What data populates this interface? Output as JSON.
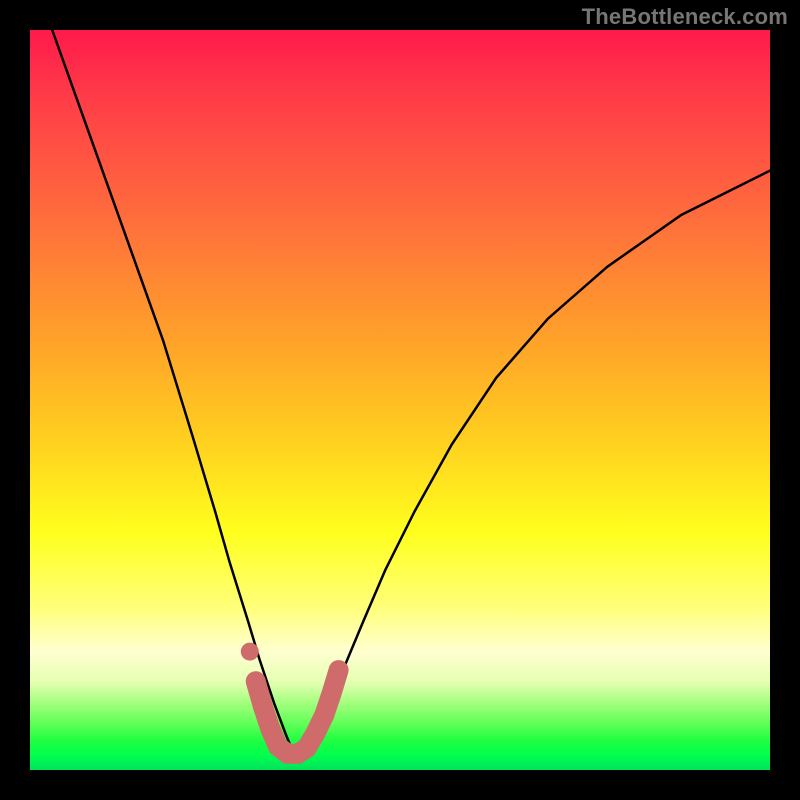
{
  "watermark": "TheBottleneck.com",
  "chart_data": {
    "type": "line",
    "title": "",
    "xlabel": "",
    "ylabel": "",
    "xlim": [
      0,
      100
    ],
    "ylim": [
      0,
      100
    ],
    "grid": false,
    "legend": false,
    "series": [
      {
        "name": "bottleneck-curve",
        "color": "#000000",
        "x": [
          3,
          8,
          13,
          18,
          22,
          25,
          27,
          29.5,
          31,
          33,
          34.5,
          35.5,
          36.5,
          38.5,
          40.5,
          42.5,
          45,
          48,
          52,
          57,
          63,
          70,
          78,
          88,
          100
        ],
        "y": [
          100,
          86,
          72,
          58,
          45,
          35,
          28,
          20,
          15,
          9,
          5,
          2.5,
          2.5,
          5,
          9,
          14,
          20,
          27,
          35,
          44,
          53,
          61,
          68,
          75,
          81
        ]
      },
      {
        "name": "bottom-highlight",
        "color": "#cf6b6b",
        "x": [
          30.5,
          31.5,
          32.5,
          33.5,
          34.8,
          36.2,
          37.4,
          38.6,
          39.8,
          40.8,
          41.7
        ],
        "y": [
          12,
          8.5,
          5.5,
          3.2,
          2.2,
          2.2,
          3.0,
          5.0,
          7.5,
          10.5,
          13.5
        ]
      },
      {
        "name": "highlight-dot",
        "color": "#cf6b6b",
        "x": [
          29.7
        ],
        "y": [
          16
        ]
      }
    ],
    "background_scale": {
      "orientation": "vertical",
      "stops": [
        {
          "pos": 0.0,
          "color": "#ff1a4b"
        },
        {
          "pos": 0.26,
          "color": "#ff6f3c"
        },
        {
          "pos": 0.56,
          "color": "#ffd21f"
        },
        {
          "pos": 0.78,
          "color": "#ffff7a"
        },
        {
          "pos": 0.9,
          "color": "#a1ff7c"
        },
        {
          "pos": 1.0,
          "color": "#00e35d"
        }
      ]
    }
  }
}
